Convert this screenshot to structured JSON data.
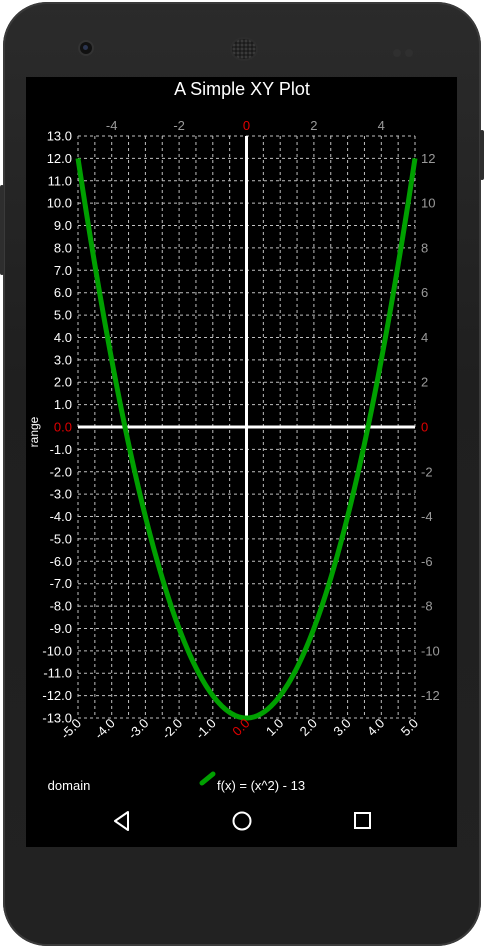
{
  "chart_data": {
    "type": "line",
    "title": "A Simple XY Plot",
    "xlabel": "domain",
    "ylabel": "range",
    "xlim": [
      -5.0,
      5.0
    ],
    "ylim": [
      -13.0,
      13.0
    ],
    "x_step": 0.5,
    "y_step": 1.0,
    "grid": true,
    "bottom_ticks": [
      "-5.0",
      "-4.0",
      "-3.0",
      "-2.0",
      "-1.0",
      "0.0",
      "1.0",
      "2.0",
      "3.0",
      "4.0",
      "5.0"
    ],
    "left_ticks": [
      "13.0",
      "12.0",
      "11.0",
      "10.0",
      "9.0",
      "8.0",
      "7.0",
      "6.0",
      "5.0",
      "4.0",
      "3.0",
      "2.0",
      "1.0",
      "0.0",
      "-1.0",
      "-2.0",
      "-3.0",
      "-4.0",
      "-5.0",
      "-6.0",
      "-7.0",
      "-8.0",
      "-9.0",
      "-10.0",
      "-11.0",
      "-12.0",
      "-13.0"
    ],
    "top_ticks": [
      "-4",
      "-2",
      "0",
      "2",
      "4"
    ],
    "right_ticks": [
      "12",
      "10",
      "8",
      "6",
      "4",
      "2",
      "0",
      "-2",
      "-4",
      "-6",
      "-8",
      "-10",
      "-12"
    ],
    "series": [
      {
        "name": "f(x) = (x^2) - 13",
        "color": "#00a000",
        "x": [
          -5.0,
          -4.5,
          -4.0,
          -3.5,
          -3.0,
          -2.5,
          -2.0,
          -1.5,
          -1.0,
          -0.5,
          0.0,
          0.5,
          1.0,
          1.5,
          2.0,
          2.5,
          3.0,
          3.5,
          4.0,
          4.5,
          5.0
        ],
        "y": [
          12.0,
          7.25,
          3.0,
          -0.75,
          -4.0,
          -6.75,
          -9.0,
          -10.75,
          -12.0,
          -12.75,
          -13.0,
          -12.75,
          -12.0,
          -10.75,
          -9.0,
          -6.75,
          -4.0,
          -0.75,
          3.0,
          7.25,
          12.0
        ]
      }
    ],
    "colors": {
      "background": "#000000",
      "grid": "#bfbfbf",
      "axis": "#ffffff",
      "zero_label": "#e00000",
      "right_ticks": "#9a9a9a"
    }
  },
  "nav": {
    "back_icon": "back-icon",
    "home_icon": "home-icon",
    "recents_icon": "recents-icon"
  }
}
